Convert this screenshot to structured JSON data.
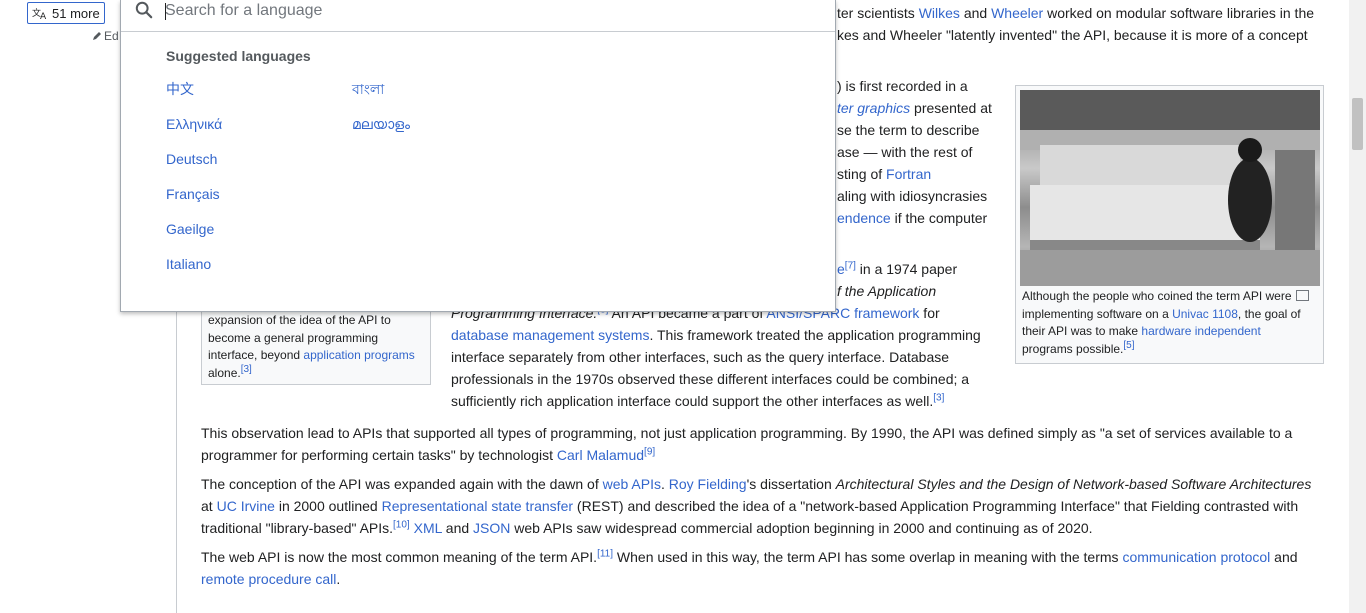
{
  "language_button": {
    "label": "51 more",
    "edit_label": "Ed"
  },
  "search": {
    "placeholder": "Search for a language"
  },
  "suggested": {
    "title": "Suggested languages",
    "col1": [
      "中文",
      "Ελληνικά",
      "Deutsch",
      "Français",
      "Gaeilge",
      "Italiano"
    ],
    "col2": [
      "বাংলা",
      "മലയാളം"
    ]
  },
  "article": {
    "l1": {
      "a": "ter scientists ",
      "b": "Wilkes",
      "c": " and ",
      "d": "Wheeler",
      "e": " worked on modular software libraries in the"
    },
    "l2": "kes and Wheeler \"latently invented\" the API, because it is more of a concept",
    "l4": ") is first recorded in a",
    "l5": {
      "a": "ter graphics",
      "b": " presented at"
    },
    "l6": "se the term to describe",
    "l7": "ase — with the rest of",
    "l8": {
      "a": "sting of ",
      "b": "Fortran"
    },
    "l9": "aling with idiosyncrasies",
    "l10": {
      "a": "endence",
      "b": " if the computer"
    },
    "l11": {
      "a": "e",
      "sup": "[7]",
      "b": " in a 1974 paper"
    },
    "l12": "f the Application",
    "l13": {
      "a": "Programming Interface.",
      "sup": "[8]",
      "b": " An API became a part of ",
      "c": "ANSI/SPARC framework",
      "d": " for"
    },
    "l14": {
      "a": "database management systems",
      "b": ". This framework treated the application programming"
    },
    "l15": "interface separately from other interfaces, such as the query interface. Database",
    "l16": "professionals in the 1970s observed these different interfaces could be combined; a",
    "l17": {
      "a": "sufficiently rich application interface could support the other interfaces as well.",
      "sup": "[3]"
    },
    "p1": {
      "a": "This observation lead to APIs that supported all types of programming, not just application programming. By 1990, the API was defined simply as \"a set of services available to a",
      "b": "programmer for performing certain tasks\" by technologist ",
      "c": "Carl Malamud",
      "sup": "[9]"
    },
    "p2": {
      "a": "The conception of the API was expanded again with the dawn of ",
      "b": "web APIs",
      "c": ". ",
      "d": "Roy Fielding",
      "e": "'s dissertation ",
      "f": "Architectural Styles and the Design of Network-based Software Architectures",
      "g": "at ",
      "h": "UC Irvine",
      "i": " in 2000 outlined ",
      "j": "Representational state transfer",
      "k": " (REST) and described the idea of a \"network-based Application Programming Interface\" that Fielding contrasted with",
      "l": "traditional \"library-based\" APIs.",
      "sup": "[10]",
      "m": " ",
      "n": "XML",
      "o": " and ",
      "p": "JSON",
      "q": " web APIs saw widespread commercial adoption beginning in 2000 and continuing as of 2020."
    },
    "p3": {
      "a": "The web API is now the most common meaning of the term API.",
      "sup": "[11]",
      "b": " When used in this way, the term API has some overlap in meaning with the terms ",
      "c": "communication protocol",
      "d": " and",
      "e": "remote procedure call",
      "f": "."
    }
  },
  "left_box": {
    "l1": "expansion of the idea of the API to",
    "l2": "become a general programming",
    "l3": "interface, beyond ",
    "link": "application programs",
    "l4": "alone.",
    "sup": "[3]"
  },
  "figure": {
    "caption1": "Although the people who coined the term API were",
    "caption2a": "implementing software on a ",
    "caption2link": "Univac 1108",
    "caption2b": ", the goal of",
    "caption3a": "their API was to make ",
    "caption3link": "hardware independent",
    "caption4": "programs possible.",
    "sup": "[5]"
  },
  "colors": {
    "link": "#3366cc",
    "text": "#202122",
    "border": "#c8ccd1"
  }
}
